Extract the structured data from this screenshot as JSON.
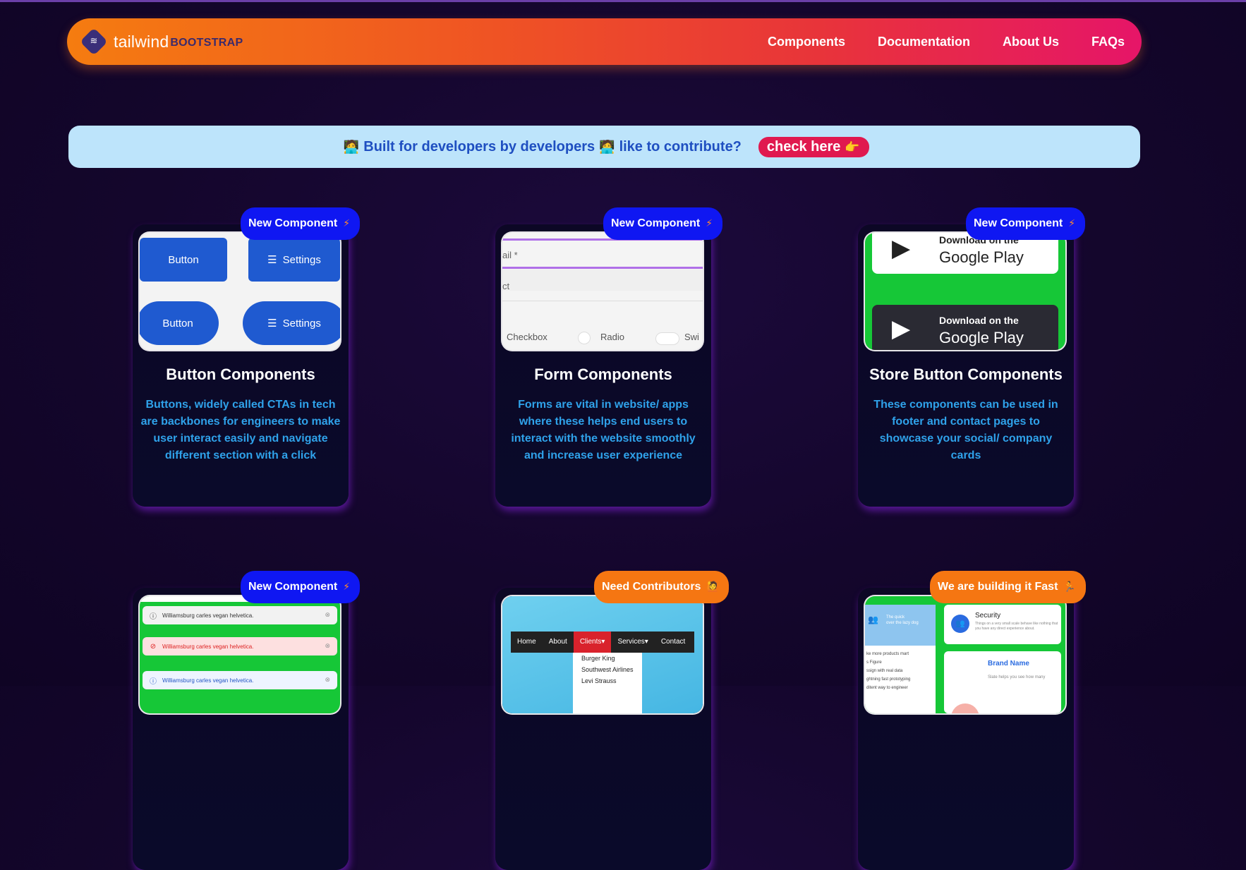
{
  "navbar": {
    "logo_word_1": "tailwind",
    "logo_word_2": "BOOTSTRAP",
    "links": [
      "Components",
      "Documentation",
      "About Us",
      "FAQs"
    ]
  },
  "banner": {
    "text_1": "Built for developers by developers",
    "text_2": "like to contribute?",
    "emoji": "🧑‍💻",
    "button_label": "check here",
    "button_emoji": "👉"
  },
  "cards": [
    {
      "badge": "New Component",
      "title": "Button Components",
      "description": "Buttons, widely called CTAs in tech are backbones for engineers to make user interact easily and navigate different section with a click",
      "preview": {
        "btn1": "Button",
        "btn2": "Settings",
        "btn3": "Button",
        "btn4": "Settings"
      }
    },
    {
      "badge": "New Component",
      "title": "Form Components",
      "description": "Forms are vital in website/ apps where these helps end users to interact with the website smoothly and increase user experience",
      "preview": {
        "field1": "ail *",
        "field2": "ct",
        "check1": "Checkbox",
        "check2": "Radio",
        "check3": "Swi"
      }
    },
    {
      "badge": "New Component",
      "title": "Store Button Components",
      "description": "These components can be used in footer and contact pages to showcase your social/ company cards",
      "preview": {
        "line1": "Download on the",
        "line2": "Google Play"
      }
    },
    {
      "badge": "New Component",
      "title": "",
      "description": "",
      "preview": {
        "alert_text": "Williamsburg carles vegan helvetica."
      }
    },
    {
      "badge": "Need Contributors",
      "title": "",
      "description": "",
      "preview": {
        "nav": [
          "Home",
          "About",
          "Clients",
          "Services",
          "Contact"
        ],
        "dropdown": [
          "Burger King",
          "Southwest Airlines",
          "Levi Strauss"
        ]
      }
    },
    {
      "badge": "We are building it Fast",
      "title": "",
      "description": "",
      "preview": {
        "left_text": "The quick\nover the lazy dog",
        "right_title": "Security",
        "right_text": "Things on a very small scale behave like nothing that you have any direct experience about.",
        "brand": "Brand Name",
        "brand_text": "Slate helps you see how many",
        "list": [
          "ke more products mart",
          "s Figure",
          "ssign with real data",
          "ghtning fast prototyping",
          "ditent way to engineer"
        ]
      }
    }
  ],
  "colors": {
    "nav_gradient_start": "#f57c10",
    "nav_gradient_end": "#e61568",
    "banner_bg": "#bde4fb",
    "banner_text": "#1f4fc1",
    "badge_blue": "#0f17f2",
    "badge_orange": "#f57612",
    "desc_text": "#2fa2ea"
  }
}
